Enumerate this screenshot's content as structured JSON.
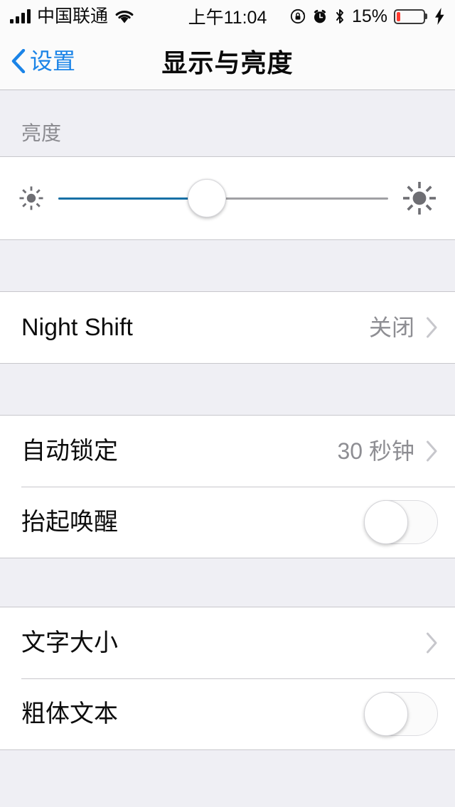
{
  "status_bar": {
    "carrier": "中国联通",
    "signal_bars": 4,
    "wifi_icon": "wifi-icon",
    "time": "上午11:04",
    "rotation_lock_icon": "rotation-lock-icon",
    "alarm_icon": "alarm-icon",
    "bluetooth_icon": "bluetooth-icon",
    "battery_percent_label": "15%",
    "battery_level": 15,
    "battery_color": "#ff3b30",
    "charging_icon": "lightning-bolt-icon"
  },
  "nav": {
    "back_label": "设置",
    "back_icon": "chevron-left-icon",
    "title": "显示与亮度",
    "accent_color": "#1b84e7"
  },
  "sections": [
    {
      "header": "亮度",
      "rows": [
        {
          "type": "slider",
          "name": "brightness-slider",
          "value_percent": 45,
          "left_icon": "sun-small-icon",
          "right_icon": "sun-large-icon",
          "fill_color": "#1570a6",
          "track_color": "#a0a0a4"
        }
      ]
    },
    {
      "header": "",
      "rows": [
        {
          "type": "disclosure",
          "name": "night-shift-row",
          "label": "Night Shift",
          "value": "关闭",
          "chevron": "chevron-right-icon"
        }
      ]
    },
    {
      "header": "",
      "rows": [
        {
          "type": "disclosure",
          "name": "auto-lock-row",
          "label": "自动锁定",
          "value": "30 秒钟",
          "chevron": "chevron-right-icon"
        },
        {
          "type": "toggle",
          "name": "raise-to-wake-row",
          "label": "抬起唤醒",
          "value": "off"
        }
      ]
    },
    {
      "header": "",
      "rows": [
        {
          "type": "disclosure",
          "name": "text-size-row",
          "label": "文字大小",
          "value": "",
          "chevron": "chevron-right-icon"
        },
        {
          "type": "toggle",
          "name": "bold-text-row",
          "label": "粗体文本",
          "value": "off"
        }
      ]
    }
  ]
}
